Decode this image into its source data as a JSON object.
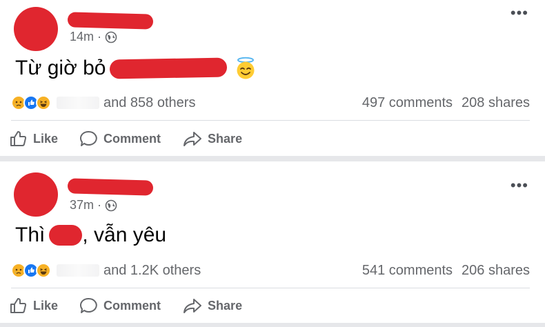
{
  "posts": [
    {
      "time": "14m",
      "dot": "·",
      "text_prefix": "Từ giờ bỏ",
      "text_suffix": "",
      "emoji": "smiling-face-with-halo",
      "reaction_summary": "and 858 others",
      "comments": "497 comments",
      "shares": "208 shares",
      "actions": {
        "like": "Like",
        "comment": "Comment",
        "share": "Share"
      }
    },
    {
      "time": "37m",
      "dot": "·",
      "text_prefix": "Thì",
      "text_suffix": ", vẫn yêu",
      "emoji": "",
      "reaction_summary": "and 1.2K others",
      "comments": "541 comments",
      "shares": "206 shares",
      "actions": {
        "like": "Like",
        "comment": "Comment",
        "share": "Share"
      }
    }
  ],
  "more_glyph": "•••",
  "colors": {
    "redaction": "#e0262f",
    "secondary_text": "#65676b",
    "like_blue": "#1877f2",
    "haha_yellow": "#f7b125"
  }
}
